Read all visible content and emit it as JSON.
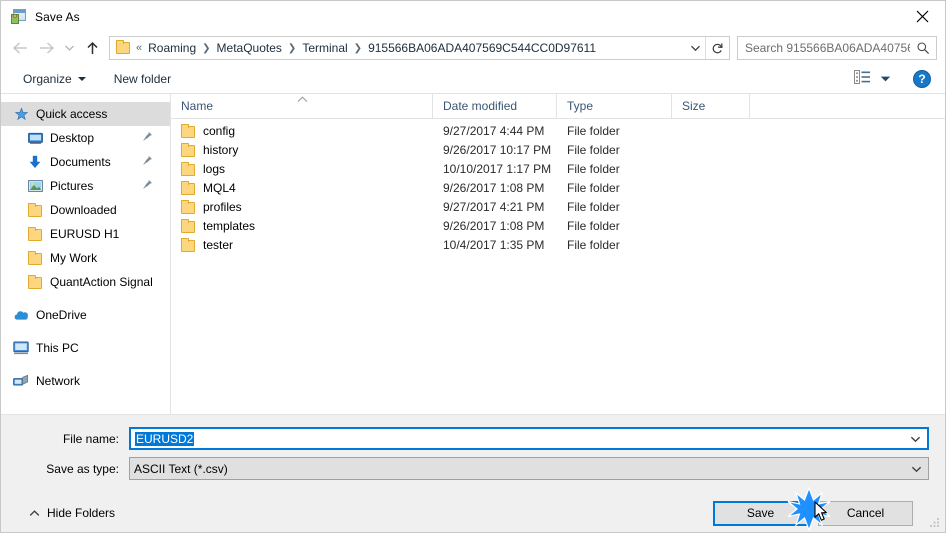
{
  "window": {
    "title": "Save As",
    "icon": "save-as-app-icon",
    "close_label": "✕"
  },
  "nav": {
    "back": "back-arrow",
    "forward": "forward-arrow",
    "recent": "recent-locations-chevron",
    "up": "up-arrow",
    "breadcrumb": {
      "overflow": "«",
      "items": [
        "Roaming",
        "MetaQuotes",
        "Terminal",
        "915566BA06ADA407569C544CC0D97611"
      ],
      "separator": "❯"
    },
    "dropdown_icon": "chevron-down-icon",
    "refresh_icon": "refresh-icon"
  },
  "search": {
    "placeholder": "Search 915566BA06ADA40756...",
    "icon": "search-icon"
  },
  "toolbar": {
    "organize": "Organize",
    "new_folder": "New folder",
    "view_icon": "view-layout-icon",
    "view_caret": "chevron-down-icon",
    "help": "?"
  },
  "sidebar": {
    "items": [
      {
        "label": "Quick access",
        "icon": "quick-access-star-icon",
        "level": 0,
        "selected": true,
        "pinned": false
      },
      {
        "label": "Desktop",
        "icon": "desktop-monitor-icon",
        "level": 1,
        "selected": false,
        "pinned": true
      },
      {
        "label": "Documents",
        "icon": "documents-download-arrow-icon",
        "level": 1,
        "selected": false,
        "pinned": true
      },
      {
        "label": "Pictures",
        "icon": "pictures-image-icon",
        "level": 1,
        "selected": false,
        "pinned": true
      },
      {
        "label": "Downloaded",
        "icon": "folder-icon",
        "level": 1,
        "selected": false,
        "pinned": false
      },
      {
        "label": "EURUSD H1",
        "icon": "folder-icon",
        "level": 1,
        "selected": false,
        "pinned": false
      },
      {
        "label": "My Work",
        "icon": "folder-icon",
        "level": 1,
        "selected": false,
        "pinned": false
      },
      {
        "label": "QuantAction Signal",
        "icon": "folder-icon",
        "level": 1,
        "selected": false,
        "pinned": false
      },
      {
        "label": "OneDrive",
        "icon": "onedrive-cloud-icon",
        "level": 0,
        "selected": false,
        "pinned": false,
        "group": true
      },
      {
        "label": "This PC",
        "icon": "this-pc-computer-icon",
        "level": 0,
        "selected": false,
        "pinned": false,
        "group": true
      },
      {
        "label": "Network",
        "icon": "network-icon",
        "level": 0,
        "selected": false,
        "pinned": false,
        "group": true
      }
    ]
  },
  "filelist": {
    "columns": [
      "Name",
      "Date modified",
      "Type",
      "Size"
    ],
    "sorted_by": "Name",
    "sort_direction": "ascending",
    "rows": [
      {
        "name": "config",
        "date": "9/27/2017 4:44 PM",
        "type": "File folder",
        "size": ""
      },
      {
        "name": "history",
        "date": "9/26/2017 10:17 PM",
        "type": "File folder",
        "size": ""
      },
      {
        "name": "logs",
        "date": "10/10/2017 1:17 PM",
        "type": "File folder",
        "size": ""
      },
      {
        "name": "MQL4",
        "date": "9/26/2017 1:08 PM",
        "type": "File folder",
        "size": ""
      },
      {
        "name": "profiles",
        "date": "9/27/2017 4:21 PM",
        "type": "File folder",
        "size": ""
      },
      {
        "name": "templates",
        "date": "9/26/2017 1:08 PM",
        "type": "File folder",
        "size": ""
      },
      {
        "name": "tester",
        "date": "10/4/2017 1:35 PM",
        "type": "File folder",
        "size": ""
      }
    ]
  },
  "form": {
    "filename_label": "File name:",
    "filename_value": "EURUSD2",
    "filename_selected": true,
    "filetype_label": "Save as type:",
    "filetype_value": "ASCII Text (*.csv)"
  },
  "buttons": {
    "hide_folders": "Hide Folders",
    "hide_folders_icon": "chevron-up-icon",
    "save": "Save",
    "cancel": "Cancel",
    "default_button": "Save"
  },
  "colors": {
    "accent": "#0078d7",
    "selection": "#0078d7",
    "folder": "#fcd77f",
    "sidebar_selected": "#dcdcdc",
    "footer_bg": "#f0f0f0",
    "help_blue": "#1878c8"
  },
  "pointer": {
    "click_indicator": "blue-starburst",
    "cursor": "arrow-pointer"
  }
}
